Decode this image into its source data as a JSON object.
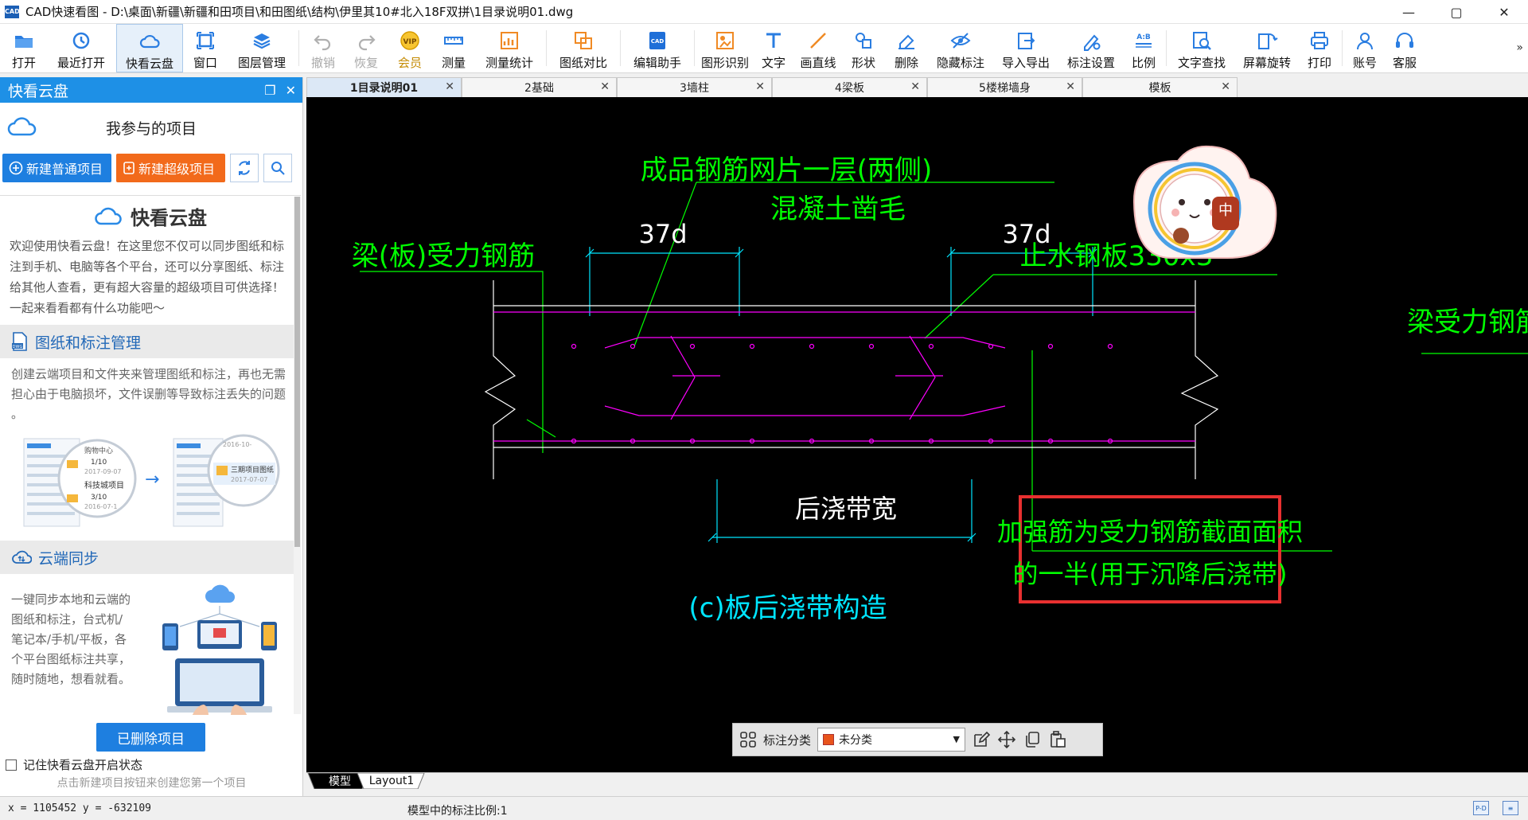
{
  "window": {
    "logo": "CAD",
    "title": "CAD快速看图 - D:\\桌面\\新疆\\新疆和田项目\\和田图纸\\结构\\伊里其10#北入18F双拼\\1目录说明01.dwg",
    "minimize": "—",
    "maximize": "▢",
    "close": "✕"
  },
  "toolbar": {
    "items": [
      {
        "label": "打开",
        "icon": "folder-icon"
      },
      {
        "label": "最近打开",
        "icon": "history-icon"
      },
      {
        "label": "快看云盘",
        "icon": "cloud-icon"
      },
      {
        "label": "窗口",
        "icon": "window-icon"
      },
      {
        "label": "图层管理",
        "icon": "layers-icon"
      },
      {
        "label": "撤销",
        "icon": "undo-icon"
      },
      {
        "label": "恢复",
        "icon": "redo-icon"
      },
      {
        "label": "会员",
        "icon": "vip-icon"
      },
      {
        "label": "测量",
        "icon": "ruler-icon"
      },
      {
        "label": "测量统计",
        "icon": "measure-stats-icon"
      },
      {
        "label": "图纸对比",
        "icon": "compare-icon"
      },
      {
        "label": "编辑助手",
        "icon": "edit-assistant-icon"
      },
      {
        "label": "图形识别",
        "icon": "shape-recognize-icon"
      },
      {
        "label": "文字",
        "icon": "text-icon"
      },
      {
        "label": "画直线",
        "icon": "line-icon"
      },
      {
        "label": "形状",
        "icon": "shape-icon"
      },
      {
        "label": "删除",
        "icon": "eraser-icon"
      },
      {
        "label": "隐藏标注",
        "icon": "hide-annotation-icon"
      },
      {
        "label": "导入导出",
        "icon": "import-export-icon"
      },
      {
        "label": "标注设置",
        "icon": "annotation-settings-icon"
      },
      {
        "label": "比例",
        "icon": "scale-icon"
      },
      {
        "label": "文字查找",
        "icon": "text-search-icon"
      },
      {
        "label": "屏幕旋转",
        "icon": "rotate-screen-icon"
      },
      {
        "label": "打印",
        "icon": "printer-icon"
      },
      {
        "label": "账号",
        "icon": "account-icon"
      },
      {
        "label": "客服",
        "icon": "headset-icon"
      }
    ],
    "more": "»"
  },
  "panel": {
    "title": "快看云盘",
    "restore": "❐",
    "close": "✕",
    "subtitle": "我参与的项目",
    "new_normal": "新建普通项目",
    "new_super": "新建超级项目",
    "cloud_title": "快看云盘",
    "welcome": "欢迎使用快看云盘！在这里您不仅可以同步图纸和标注到手机、电脑等各个平台，还可以分享图纸、标注给其他人查看，更有超大容量的超级项目可供选择！一起来看看都有什么功能吧～",
    "section1_title": "图纸和标注管理",
    "section1_body": "创建云端项目和文件夹来管理图纸和标注，再也无需担心由于电脑损坏，文件误删等导致标注丢失的问题 。",
    "illus1": {
      "a_line1": "购物中心",
      "a_line2": "1/10",
      "a_date1": "2017-09-07",
      "a_line3": "科技城项目",
      "a_line4": "3/10",
      "a_date2": "2016-07-1",
      "b_date0": "2016-10-",
      "b_line1": "三期项目图纸",
      "b_date1": "2017-07-07",
      "arrow": "→"
    },
    "section2_title": "云端同步",
    "section2_body": "一键同步本地和云端的图纸和标注，台式机/笔记本/手机/平板，各个平台图纸标注共享，随时随地，想看就看。",
    "deleted_projects": "已删除项目",
    "remember": "记住快看云盘开启状态",
    "hint": "点击新建项目按钮来创建您第一个项目"
  },
  "tabs": [
    {
      "label": "1目录说明01",
      "active": true
    },
    {
      "label": "2基础",
      "active": false
    },
    {
      "label": "3墙柱",
      "active": false
    },
    {
      "label": "4梁板",
      "active": false
    },
    {
      "label": "5楼梯墙身",
      "active": false
    },
    {
      "label": "模板",
      "active": false
    }
  ],
  "tab_close": "✕",
  "drawing": {
    "label_mesh": "成品钢筋网片一层(两侧)",
    "label_concrete": "混凝土凿毛",
    "label_rebar_left": "梁(板)受力钢筋",
    "dim_left": "37d",
    "dim_right": "37d",
    "label_waterstop": "止水钢板330x3",
    "label_beam_rebar": "梁受力钢筋",
    "label_post_width": "后浇带宽",
    "caption": "(c)板后浇带构造",
    "note_line1": "加强筋为受力钢筋截面面积",
    "note_line2": "的一半(用于沉降后浇带)",
    "sticker_char": "中",
    "colors": {
      "text_green": "#00ff00",
      "dim_cyan": "#00e5ff",
      "rebar_magenta": "#ff00ff",
      "outline_white": "#ffffff",
      "highlight_red": "#e83030"
    }
  },
  "annotation_bar": {
    "category_label": "标注分类",
    "category_value": "未分类",
    "category_color": "#e8541c"
  },
  "layout_tabs": {
    "model": "模型",
    "layout1": "Layout1"
  },
  "status": {
    "coords": "x = 1105452  y = -632109",
    "scale": "模型中的标注比例:1",
    "icon1": "P-D",
    "icon2": "≡"
  }
}
